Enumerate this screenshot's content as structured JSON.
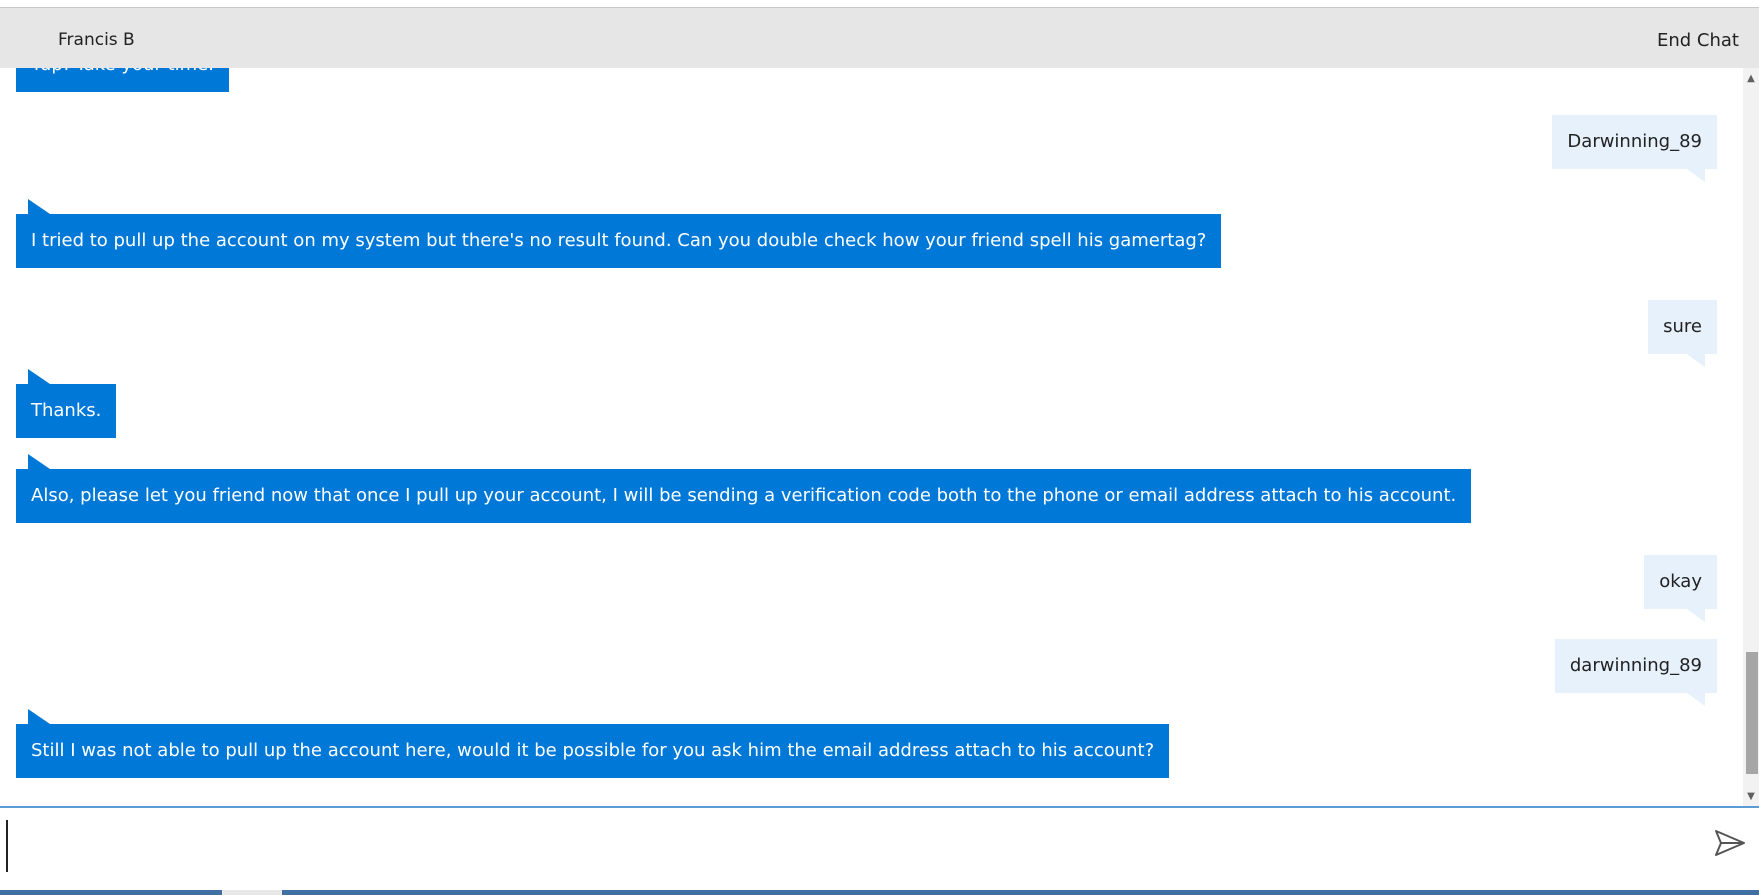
{
  "header": {
    "agent_name": "Francis B",
    "end_chat_label": "End Chat"
  },
  "messages": [
    {
      "from": "agent",
      "text": "Yup! Take your time."
    },
    {
      "from": "user",
      "text": "Darwinning_89"
    },
    {
      "from": "agent",
      "text": "I tried to pull up the account on my system but there's no result found. Can you double check how your friend spell his gamertag?"
    },
    {
      "from": "user",
      "text": "sure"
    },
    {
      "from": "agent",
      "text": "Thanks."
    },
    {
      "from": "agent",
      "text": "Also, please let you friend now that once I pull up your account, I will be sending a verification code both to the  phone or email address attach to his account."
    },
    {
      "from": "user",
      "text": "okay"
    },
    {
      "from": "user",
      "text": "darwinning_89"
    },
    {
      "from": "agent",
      "text": "Still I was not able to pull up the account here, would it be possible for you ask him the email address attach to his account?"
    }
  ],
  "composer": {
    "value": "",
    "send_icon": "send-icon"
  },
  "colors": {
    "agent_bubble": "#0078d7",
    "user_bubble": "#e6f1fb",
    "header_bg": "#e6e6e6",
    "composer_border": "#5b9bd5"
  }
}
